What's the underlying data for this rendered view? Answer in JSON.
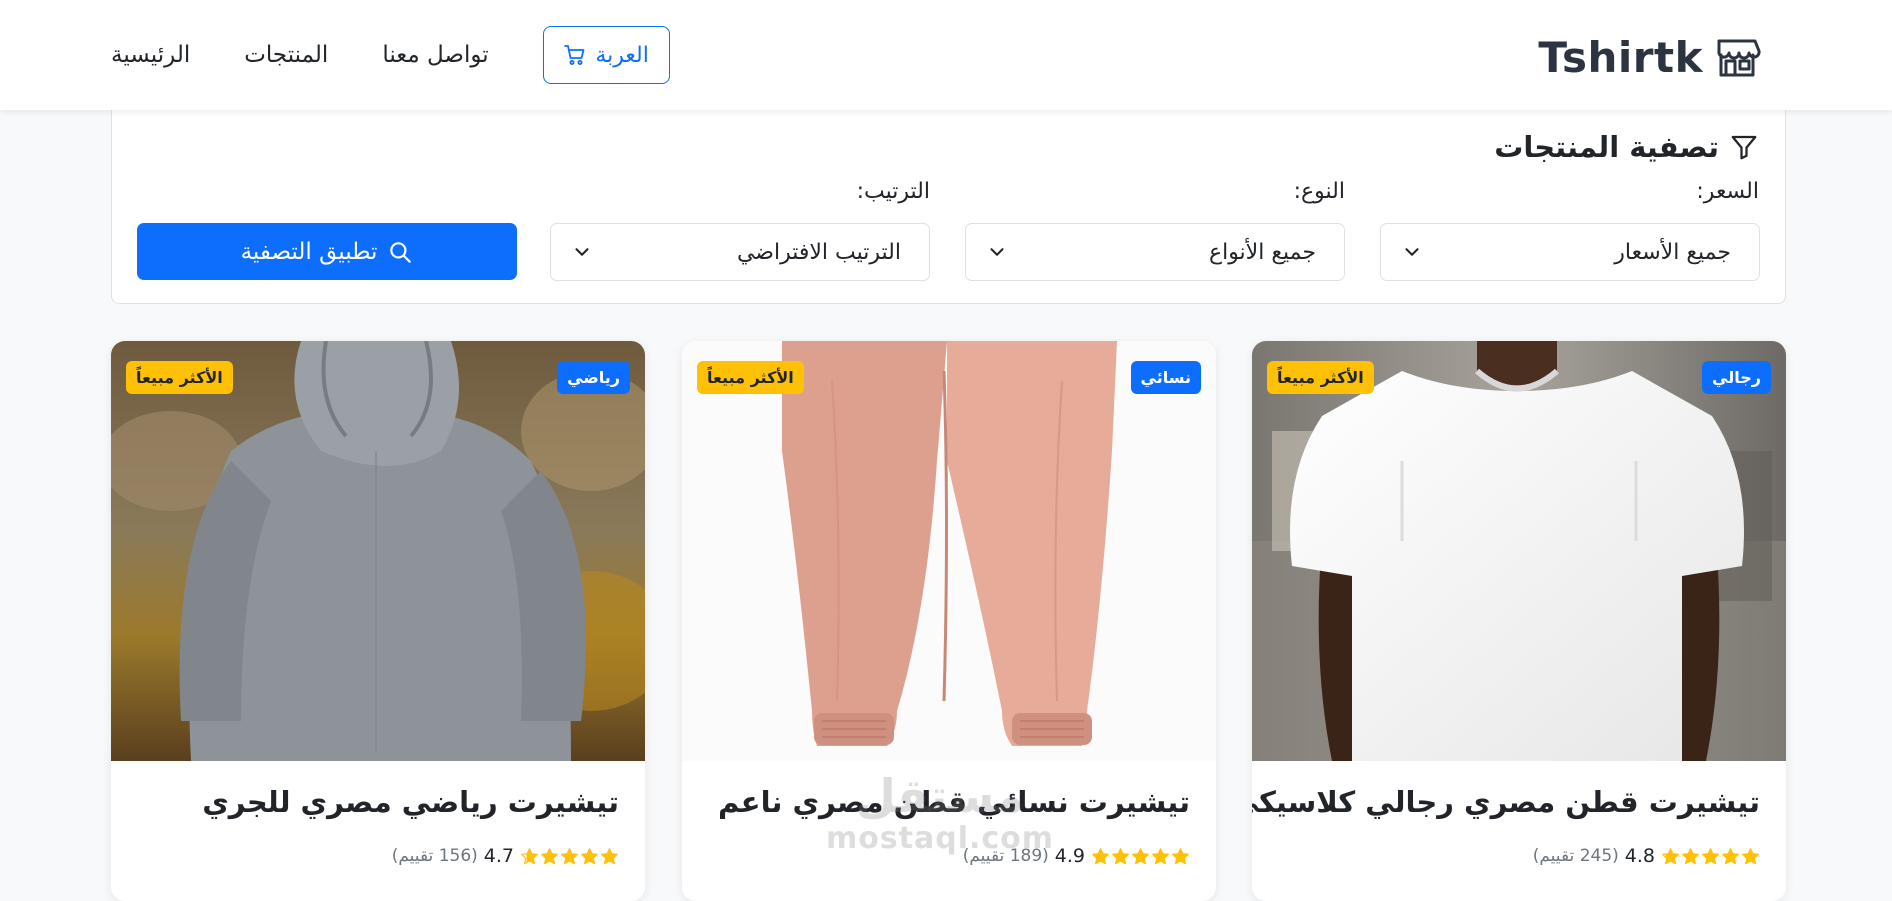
{
  "colors": {
    "primary": "#0d6efd",
    "warning": "#ffc107",
    "text": "#212529",
    "muted": "#6c757d",
    "brand_text": "#2b3440"
  },
  "navbar": {
    "brand": {
      "name": "Tshirtk",
      "icon": "shop-icon"
    },
    "links": [
      {
        "label": "الرئيسية"
      },
      {
        "label": "المنتجات"
      },
      {
        "label": "تواصل معنا"
      }
    ],
    "cart": {
      "label": "العربة",
      "icon": "cart-icon"
    }
  },
  "filter": {
    "title": "تصفية المنتجات",
    "title_icon": "funnel-icon",
    "price": {
      "label": "السعر:",
      "value": "جميع الأسعار"
    },
    "type": {
      "label": "النوع:",
      "value": "جميع الأنواع"
    },
    "sort": {
      "label": "الترتيب:",
      "value": "الترتيب الافتراضي"
    },
    "apply": {
      "label": "تطبيق التصفية",
      "icon": "search-icon"
    }
  },
  "products": [
    {
      "name": "تيشيرت قطن مصري رجالي كلاسيكي",
      "category": "رجالي",
      "badge": "الأكثر مبيعاً",
      "rating": "4.8",
      "rating_value": 4.8,
      "reviews": "(245 تقييم)",
      "image": "white-tshirt-man"
    },
    {
      "name": "تيشيرت نسائي قطن مصري ناعم",
      "category": "نسائي",
      "badge": "الأكثر مبيعاً",
      "rating": "4.9",
      "rating_value": 4.9,
      "reviews": "(189 تقييم)",
      "image": "pink-jogger-pants"
    },
    {
      "name": "تيشيرت رياضي مصري للجري",
      "category": "رياضي",
      "badge": "الأكثر مبيعاً",
      "rating": "4.7",
      "rating_value": 4.7,
      "reviews": "(156 تقييم)",
      "image": "grey-hoodie-runner"
    }
  ],
  "watermark": {
    "ar": "مستقل",
    "en": "mostaql.com"
  }
}
